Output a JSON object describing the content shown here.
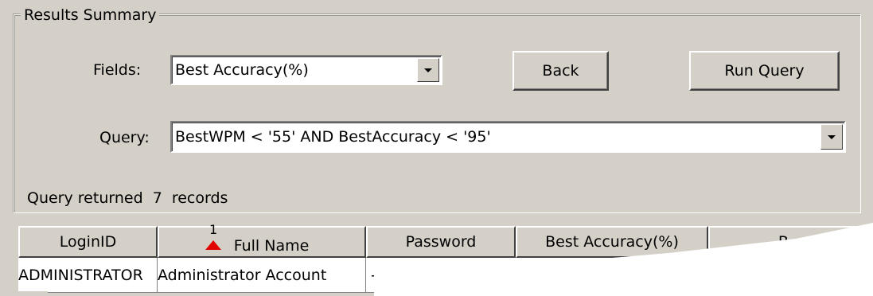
{
  "panel": {
    "title": "Results Summary",
    "fields_label": "Fields:",
    "fields_value": "Best Accuracy(%)",
    "query_label": "Query:",
    "query_value": "BestWPM < '55' AND BestAccuracy < '95'",
    "back_label": "Back",
    "run_query_label": "Run Query",
    "status_prefix": "Query returned",
    "status_count": "7",
    "status_suffix": "records"
  },
  "table": {
    "columns": [
      "LoginID",
      "Full Name",
      "Password",
      "Best Accuracy(%)",
      "B..."
    ],
    "sort_index": "1",
    "rows": [
      [
        "ADMINISTRATOR",
        "Administrator Account",
        "-"
      ]
    ]
  },
  "colors": {
    "background": "#d4d0c8",
    "sort_indicator": "#e00000"
  }
}
